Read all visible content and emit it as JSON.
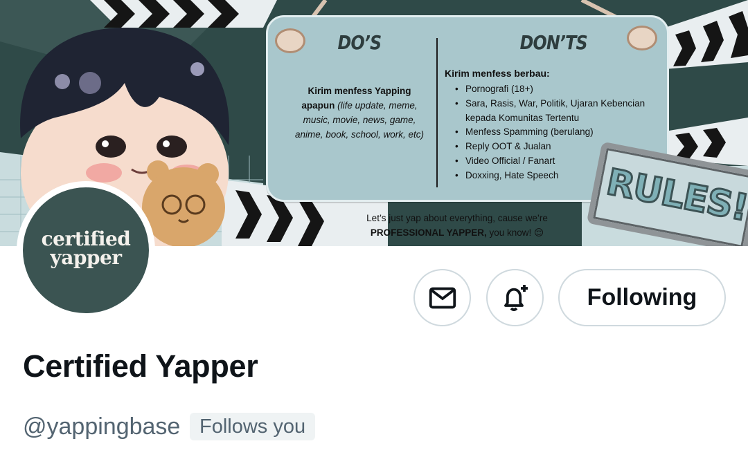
{
  "banner": {
    "dos_heading": "DO’S",
    "donts_heading": "DON’TS",
    "dos_bold": "Kirim menfess Yapping apapun",
    "dos_italic": "(life update, meme, music, movie, news, game, anime, book, school, work, etc)",
    "donts_title": "Kirim menfess berbau:",
    "donts_items": [
      "Pornografi (18+)",
      "Sara, Rasis, War, Politik, Ujaran Kebencian kepada Komunitas Tertentu",
      "Menfess Spamming (berulang)",
      "Reply OOT & Jualan",
      "Video Official / Fanart",
      "Doxxing, Hate Speech"
    ],
    "tagline_line1": "Let’s just yap about everything, cause we’re",
    "tagline_bold": "PROFESSIONAL YAPPER,",
    "tagline_rest": "you know! 😌",
    "rules_sign": "RULES!"
  },
  "avatar": {
    "line1": "certified",
    "line2": "yapper"
  },
  "actions": {
    "message_icon": "envelope-icon",
    "notify_icon": "bell-plus-icon",
    "follow_label": "Following"
  },
  "profile": {
    "display_name": "Certified Yapper",
    "handle": "@yappingbase",
    "follows_you": "Follows you"
  },
  "colors": {
    "banner_dark": "#2f4a48",
    "board": "#a9c7cc",
    "avatar_bg": "#3b5452",
    "secondary_text": "#536471",
    "border": "#cfd9de"
  }
}
